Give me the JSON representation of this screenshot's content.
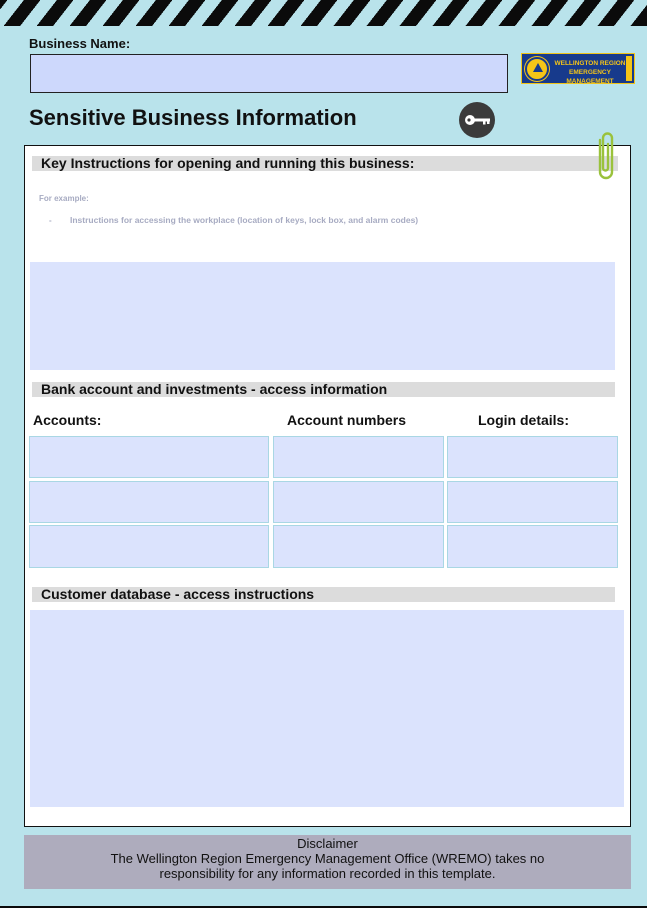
{
  "header": {
    "business_name_label": "Business Name:",
    "business_name_value": "",
    "title": "Sensitive Business Information"
  },
  "logo": {
    "text": "WELLINGTON REGION EMERGENCY MANAGEMENT"
  },
  "sections": {
    "key_instructions": {
      "heading": "Key Instructions for opening and running this business:",
      "example_label": "For example:",
      "bullet": "-",
      "example_item": "Instructions for accessing the workplace (location of keys, lock box, and alarm codes)",
      "value": ""
    },
    "bank": {
      "heading": "Bank account and investments - access information",
      "columns": [
        "Accounts:",
        "Account numbers",
        "Login details:"
      ],
      "rows": [
        [
          "",
          "",
          ""
        ],
        [
          "",
          "",
          ""
        ],
        [
          "",
          "",
          ""
        ]
      ]
    },
    "customer_db": {
      "heading": "Customer database - access instructions",
      "value": ""
    }
  },
  "disclaimer": {
    "title": "Disclaimer",
    "text": "The Wellington Region Emergency Management Office (WREMO) takes no responsibility for any information recorded in this template."
  },
  "icons": [
    "key-icon",
    "paperclip-icon",
    "civil-defence-seal-icon"
  ],
  "colors": {
    "page_background": "#b9e3eb",
    "input_fill": "#dbe3fd",
    "section_bar": "#dcdcdc",
    "disclaimer_background": "#aeacbd",
    "logo_blue": "#173a8c",
    "logo_yellow": "#f5c518"
  }
}
